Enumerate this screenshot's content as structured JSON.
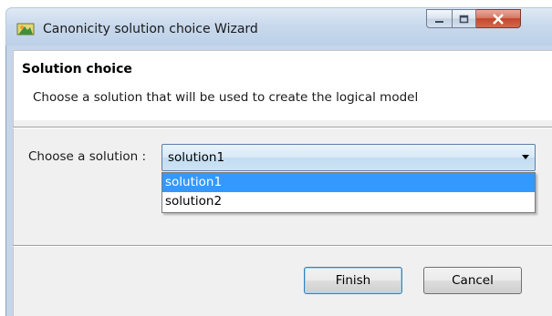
{
  "window": {
    "title": "Canonicity solution choice Wizard",
    "icon": "eclipse-app-icon"
  },
  "header": {
    "title": "Solution choice",
    "description": "Choose a solution that will be used to create the logical model"
  },
  "form": {
    "choose_label": "Choose a solution :",
    "selected_value": "solution1",
    "options": [
      "solution1",
      "solution2"
    ]
  },
  "buttons": {
    "finish": "Finish",
    "cancel": "Cancel"
  },
  "colors": {
    "selection": "#3399ff",
    "close_button": "#c5452c"
  }
}
